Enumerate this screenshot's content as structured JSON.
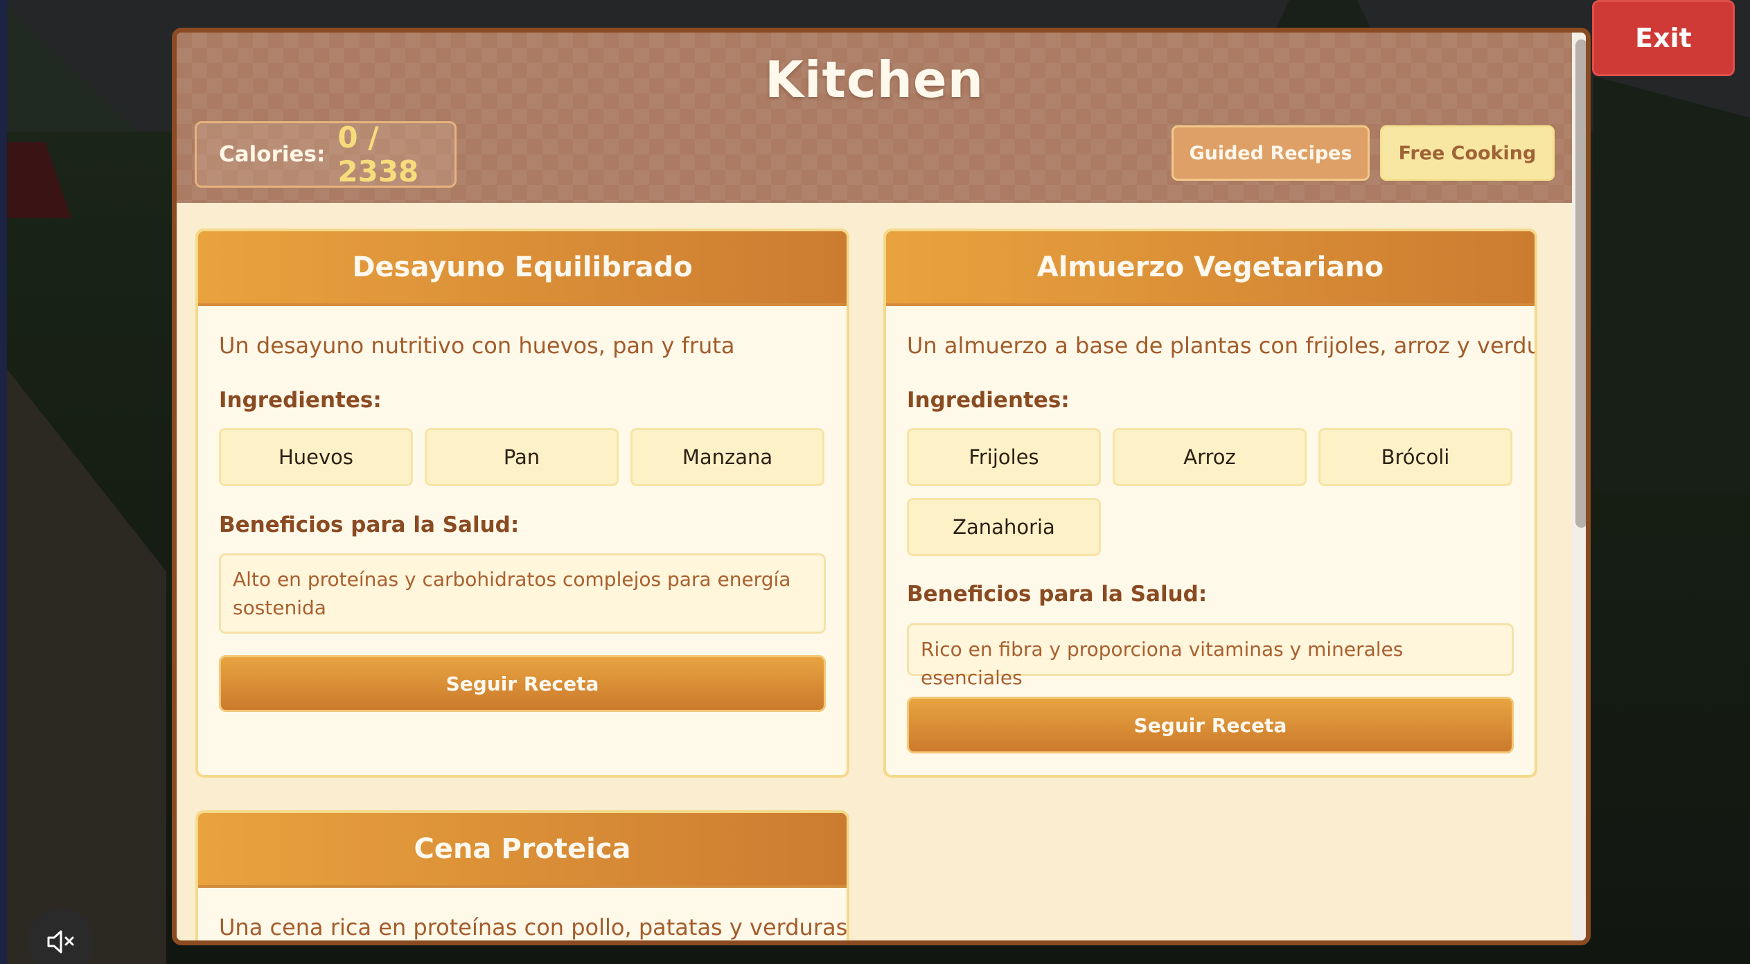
{
  "exit_label": "Exit",
  "kitchen": {
    "title": "Kitchen",
    "calories_label": "Calories:",
    "calories_value": "0 / 2338",
    "modes": {
      "guided": "Guided Recipes",
      "free": "Free Cooking"
    }
  },
  "ingredients_label": "Ingredientes:",
  "benefits_label": "Beneficios para la Salud:",
  "recipes": [
    {
      "name": "Desayuno Equilibrado",
      "description": "Un desayuno nutritivo con huevos, pan y fruta",
      "ingredients": [
        "Huevos",
        "Pan",
        "Manzana"
      ],
      "benefits": "Alto en proteínas y carbohidratos complejos para energía sostenida",
      "button": "Seguir Receta"
    },
    {
      "name": "Almuerzo Vegetariano",
      "description": "Un almuerzo a base de plantas con frijoles, arroz y verduras",
      "ingredients": [
        "Frijoles",
        "Arroz",
        "Brócoli",
        "Zanahoria"
      ],
      "benefits": "Rico en fibra y proporciona vitaminas y minerales esenciales",
      "button": "Seguir Receta"
    },
    {
      "name": "Cena Proteica",
      "description": "Una cena rica en proteínas con pollo, patatas y verduras"
    }
  ],
  "icons": {
    "mute": "speaker-muted-icon"
  },
  "colors": {
    "accent": "#cc7c30",
    "exit": "#cf3a36",
    "header": "#ab7b63"
  }
}
